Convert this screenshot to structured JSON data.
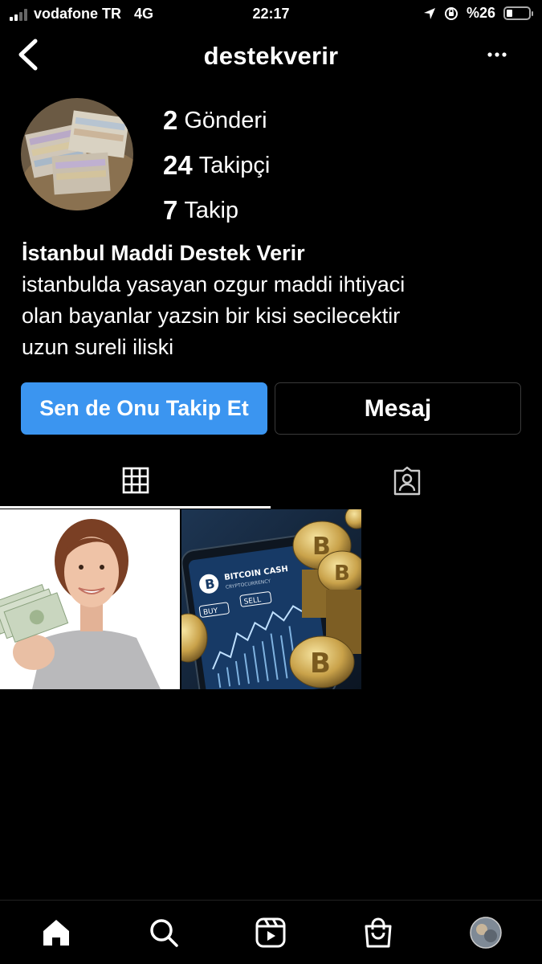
{
  "status_bar": {
    "carrier": "vodafone TR",
    "network": "4G",
    "time": "22:17",
    "battery": "%26",
    "battery_level": 0.26
  },
  "header": {
    "username": "destekverir"
  },
  "profile": {
    "stats": [
      {
        "count": "2",
        "label": "Gönderi"
      },
      {
        "count": "24",
        "label": "Takipçi"
      },
      {
        "count": "7",
        "label": "Takip"
      }
    ],
    "name": "İstanbul Maddi Destek Verir",
    "bio_lines": [
      "istanbulda yasayan ozgur maddi ihtiyaci",
      "olan bayanlar yazsin bir kisi secilecektir",
      "uzun sureli iliski"
    ]
  },
  "actions": {
    "follow_label": "Sen de Onu Takip Et",
    "message_label": "Mesaj"
  },
  "posts": {
    "post2_texts": {
      "brand": "BITCOIN CASH",
      "sub": "CRYPTOCURRENCY",
      "buy": "BUY",
      "sell": "SELL"
    }
  },
  "colors": {
    "background": "#000000",
    "follow_button": "#3b95f0",
    "message_border": "#3a3a3a"
  },
  "icons": {
    "back": "chevron-left-icon",
    "more": "more-horizontal-icon",
    "grid": "grid-icon",
    "tagged": "tagged-person-icon",
    "home": "home-icon",
    "search": "search-icon",
    "reels": "reels-icon",
    "shop": "shopping-bag-icon"
  }
}
